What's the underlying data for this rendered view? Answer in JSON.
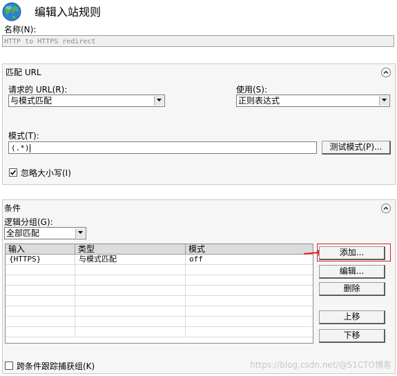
{
  "window": {
    "title": "编辑入站规则",
    "icon": "globe-icon"
  },
  "rule_name": {
    "label": "名称(N):",
    "value": "HTTP to HTTPS redirect"
  },
  "match_url": {
    "section_title": "匹配 URL",
    "requested_url_label": "请求的 URL(R):",
    "requested_url_value": "与模式匹配",
    "using_label": "使用(S):",
    "using_value": "正则表达式",
    "pattern_label": "模式(T):",
    "pattern_value": "(.*)",
    "test_pattern_button": "测试模式(P)...",
    "ignore_case_label": "忽略大小写(I)",
    "ignore_case_checked": true
  },
  "conditions": {
    "section_title": "条件",
    "logical_grouping_label": "逻辑分组(G):",
    "logical_grouping_value": "全部匹配",
    "table": {
      "headers": [
        "输入",
        "类型",
        "模式"
      ],
      "rows": [
        [
          "{HTTPS}",
          "与模式匹配",
          "off"
        ]
      ]
    },
    "buttons": {
      "add": "添加...",
      "edit": "编辑...",
      "delete": "删除",
      "move_up": "上移",
      "move_down": "下移"
    },
    "track_captures_label": "跨条件跟踪捕获组(K)",
    "track_captures_checked": false
  },
  "annotation": {
    "arrow_color": "#e02020",
    "highlight_color": "#e02020"
  },
  "watermark": "https://blog.csdn.net/@51CTO博客"
}
